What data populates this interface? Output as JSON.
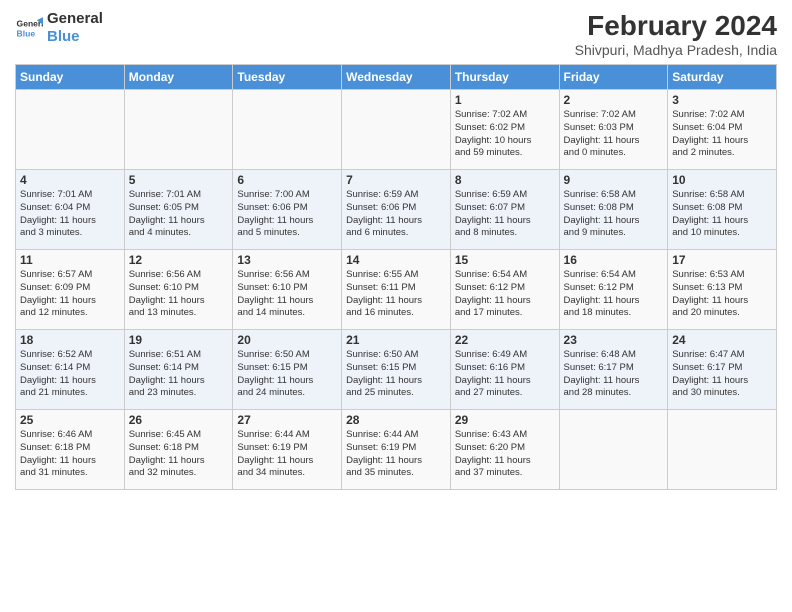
{
  "logo": {
    "line1": "General",
    "line2": "Blue"
  },
  "title": "February 2024",
  "subtitle": "Shivpuri, Madhya Pradesh, India",
  "headers": [
    "Sunday",
    "Monday",
    "Tuesday",
    "Wednesday",
    "Thursday",
    "Friday",
    "Saturday"
  ],
  "weeks": [
    [
      {
        "day": "",
        "info": ""
      },
      {
        "day": "",
        "info": ""
      },
      {
        "day": "",
        "info": ""
      },
      {
        "day": "",
        "info": ""
      },
      {
        "day": "1",
        "info": "Sunrise: 7:02 AM\nSunset: 6:02 PM\nDaylight: 10 hours\nand 59 minutes."
      },
      {
        "day": "2",
        "info": "Sunrise: 7:02 AM\nSunset: 6:03 PM\nDaylight: 11 hours\nand 0 minutes."
      },
      {
        "day": "3",
        "info": "Sunrise: 7:02 AM\nSunset: 6:04 PM\nDaylight: 11 hours\nand 2 minutes."
      }
    ],
    [
      {
        "day": "4",
        "info": "Sunrise: 7:01 AM\nSunset: 6:04 PM\nDaylight: 11 hours\nand 3 minutes."
      },
      {
        "day": "5",
        "info": "Sunrise: 7:01 AM\nSunset: 6:05 PM\nDaylight: 11 hours\nand 4 minutes."
      },
      {
        "day": "6",
        "info": "Sunrise: 7:00 AM\nSunset: 6:06 PM\nDaylight: 11 hours\nand 5 minutes."
      },
      {
        "day": "7",
        "info": "Sunrise: 6:59 AM\nSunset: 6:06 PM\nDaylight: 11 hours\nand 6 minutes."
      },
      {
        "day": "8",
        "info": "Sunrise: 6:59 AM\nSunset: 6:07 PM\nDaylight: 11 hours\nand 8 minutes."
      },
      {
        "day": "9",
        "info": "Sunrise: 6:58 AM\nSunset: 6:08 PM\nDaylight: 11 hours\nand 9 minutes."
      },
      {
        "day": "10",
        "info": "Sunrise: 6:58 AM\nSunset: 6:08 PM\nDaylight: 11 hours\nand 10 minutes."
      }
    ],
    [
      {
        "day": "11",
        "info": "Sunrise: 6:57 AM\nSunset: 6:09 PM\nDaylight: 11 hours\nand 12 minutes."
      },
      {
        "day": "12",
        "info": "Sunrise: 6:56 AM\nSunset: 6:10 PM\nDaylight: 11 hours\nand 13 minutes."
      },
      {
        "day": "13",
        "info": "Sunrise: 6:56 AM\nSunset: 6:10 PM\nDaylight: 11 hours\nand 14 minutes."
      },
      {
        "day": "14",
        "info": "Sunrise: 6:55 AM\nSunset: 6:11 PM\nDaylight: 11 hours\nand 16 minutes."
      },
      {
        "day": "15",
        "info": "Sunrise: 6:54 AM\nSunset: 6:12 PM\nDaylight: 11 hours\nand 17 minutes."
      },
      {
        "day": "16",
        "info": "Sunrise: 6:54 AM\nSunset: 6:12 PM\nDaylight: 11 hours\nand 18 minutes."
      },
      {
        "day": "17",
        "info": "Sunrise: 6:53 AM\nSunset: 6:13 PM\nDaylight: 11 hours\nand 20 minutes."
      }
    ],
    [
      {
        "day": "18",
        "info": "Sunrise: 6:52 AM\nSunset: 6:14 PM\nDaylight: 11 hours\nand 21 minutes."
      },
      {
        "day": "19",
        "info": "Sunrise: 6:51 AM\nSunset: 6:14 PM\nDaylight: 11 hours\nand 23 minutes."
      },
      {
        "day": "20",
        "info": "Sunrise: 6:50 AM\nSunset: 6:15 PM\nDaylight: 11 hours\nand 24 minutes."
      },
      {
        "day": "21",
        "info": "Sunrise: 6:50 AM\nSunset: 6:15 PM\nDaylight: 11 hours\nand 25 minutes."
      },
      {
        "day": "22",
        "info": "Sunrise: 6:49 AM\nSunset: 6:16 PM\nDaylight: 11 hours\nand 27 minutes."
      },
      {
        "day": "23",
        "info": "Sunrise: 6:48 AM\nSunset: 6:17 PM\nDaylight: 11 hours\nand 28 minutes."
      },
      {
        "day": "24",
        "info": "Sunrise: 6:47 AM\nSunset: 6:17 PM\nDaylight: 11 hours\nand 30 minutes."
      }
    ],
    [
      {
        "day": "25",
        "info": "Sunrise: 6:46 AM\nSunset: 6:18 PM\nDaylight: 11 hours\nand 31 minutes."
      },
      {
        "day": "26",
        "info": "Sunrise: 6:45 AM\nSunset: 6:18 PM\nDaylight: 11 hours\nand 32 minutes."
      },
      {
        "day": "27",
        "info": "Sunrise: 6:44 AM\nSunset: 6:19 PM\nDaylight: 11 hours\nand 34 minutes."
      },
      {
        "day": "28",
        "info": "Sunrise: 6:44 AM\nSunset: 6:19 PM\nDaylight: 11 hours\nand 35 minutes."
      },
      {
        "day": "29",
        "info": "Sunrise: 6:43 AM\nSunset: 6:20 PM\nDaylight: 11 hours\nand 37 minutes."
      },
      {
        "day": "",
        "info": ""
      },
      {
        "day": "",
        "info": ""
      }
    ]
  ]
}
